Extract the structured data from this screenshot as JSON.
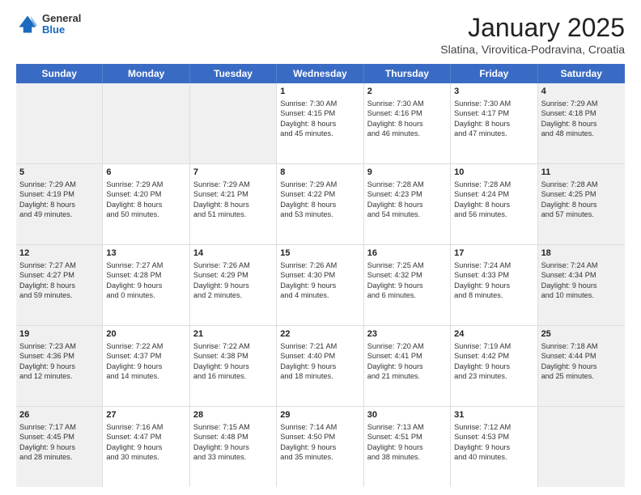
{
  "header": {
    "logo_general": "General",
    "logo_blue": "Blue",
    "month_title": "January 2025",
    "location": "Slatina, Virovitica-Podravina, Croatia"
  },
  "weekdays": [
    "Sunday",
    "Monday",
    "Tuesday",
    "Wednesday",
    "Thursday",
    "Friday",
    "Saturday"
  ],
  "rows": [
    [
      {
        "day": "",
        "text": "",
        "shaded": true,
        "empty": true
      },
      {
        "day": "",
        "text": "",
        "shaded": true,
        "empty": true
      },
      {
        "day": "",
        "text": "",
        "shaded": true,
        "empty": true
      },
      {
        "day": "1",
        "text": "Sunrise: 7:30 AM\nSunset: 4:15 PM\nDaylight: 8 hours\nand 45 minutes.",
        "shaded": false
      },
      {
        "day": "2",
        "text": "Sunrise: 7:30 AM\nSunset: 4:16 PM\nDaylight: 8 hours\nand 46 minutes.",
        "shaded": false
      },
      {
        "day": "3",
        "text": "Sunrise: 7:30 AM\nSunset: 4:17 PM\nDaylight: 8 hours\nand 47 minutes.",
        "shaded": false
      },
      {
        "day": "4",
        "text": "Sunrise: 7:29 AM\nSunset: 4:18 PM\nDaylight: 8 hours\nand 48 minutes.",
        "shaded": true
      }
    ],
    [
      {
        "day": "5",
        "text": "Sunrise: 7:29 AM\nSunset: 4:19 PM\nDaylight: 8 hours\nand 49 minutes.",
        "shaded": true
      },
      {
        "day": "6",
        "text": "Sunrise: 7:29 AM\nSunset: 4:20 PM\nDaylight: 8 hours\nand 50 minutes.",
        "shaded": false
      },
      {
        "day": "7",
        "text": "Sunrise: 7:29 AM\nSunset: 4:21 PM\nDaylight: 8 hours\nand 51 minutes.",
        "shaded": false
      },
      {
        "day": "8",
        "text": "Sunrise: 7:29 AM\nSunset: 4:22 PM\nDaylight: 8 hours\nand 53 minutes.",
        "shaded": false
      },
      {
        "day": "9",
        "text": "Sunrise: 7:28 AM\nSunset: 4:23 PM\nDaylight: 8 hours\nand 54 minutes.",
        "shaded": false
      },
      {
        "day": "10",
        "text": "Sunrise: 7:28 AM\nSunset: 4:24 PM\nDaylight: 8 hours\nand 56 minutes.",
        "shaded": false
      },
      {
        "day": "11",
        "text": "Sunrise: 7:28 AM\nSunset: 4:25 PM\nDaylight: 8 hours\nand 57 minutes.",
        "shaded": true
      }
    ],
    [
      {
        "day": "12",
        "text": "Sunrise: 7:27 AM\nSunset: 4:27 PM\nDaylight: 8 hours\nand 59 minutes.",
        "shaded": true
      },
      {
        "day": "13",
        "text": "Sunrise: 7:27 AM\nSunset: 4:28 PM\nDaylight: 9 hours\nand 0 minutes.",
        "shaded": false
      },
      {
        "day": "14",
        "text": "Sunrise: 7:26 AM\nSunset: 4:29 PM\nDaylight: 9 hours\nand 2 minutes.",
        "shaded": false
      },
      {
        "day": "15",
        "text": "Sunrise: 7:26 AM\nSunset: 4:30 PM\nDaylight: 9 hours\nand 4 minutes.",
        "shaded": false
      },
      {
        "day": "16",
        "text": "Sunrise: 7:25 AM\nSunset: 4:32 PM\nDaylight: 9 hours\nand 6 minutes.",
        "shaded": false
      },
      {
        "day": "17",
        "text": "Sunrise: 7:24 AM\nSunset: 4:33 PM\nDaylight: 9 hours\nand 8 minutes.",
        "shaded": false
      },
      {
        "day": "18",
        "text": "Sunrise: 7:24 AM\nSunset: 4:34 PM\nDaylight: 9 hours\nand 10 minutes.",
        "shaded": true
      }
    ],
    [
      {
        "day": "19",
        "text": "Sunrise: 7:23 AM\nSunset: 4:36 PM\nDaylight: 9 hours\nand 12 minutes.",
        "shaded": true
      },
      {
        "day": "20",
        "text": "Sunrise: 7:22 AM\nSunset: 4:37 PM\nDaylight: 9 hours\nand 14 minutes.",
        "shaded": false
      },
      {
        "day": "21",
        "text": "Sunrise: 7:22 AM\nSunset: 4:38 PM\nDaylight: 9 hours\nand 16 minutes.",
        "shaded": false
      },
      {
        "day": "22",
        "text": "Sunrise: 7:21 AM\nSunset: 4:40 PM\nDaylight: 9 hours\nand 18 minutes.",
        "shaded": false
      },
      {
        "day": "23",
        "text": "Sunrise: 7:20 AM\nSunset: 4:41 PM\nDaylight: 9 hours\nand 21 minutes.",
        "shaded": false
      },
      {
        "day": "24",
        "text": "Sunrise: 7:19 AM\nSunset: 4:42 PM\nDaylight: 9 hours\nand 23 minutes.",
        "shaded": false
      },
      {
        "day": "25",
        "text": "Sunrise: 7:18 AM\nSunset: 4:44 PM\nDaylight: 9 hours\nand 25 minutes.",
        "shaded": true
      }
    ],
    [
      {
        "day": "26",
        "text": "Sunrise: 7:17 AM\nSunset: 4:45 PM\nDaylight: 9 hours\nand 28 minutes.",
        "shaded": true
      },
      {
        "day": "27",
        "text": "Sunrise: 7:16 AM\nSunset: 4:47 PM\nDaylight: 9 hours\nand 30 minutes.",
        "shaded": false
      },
      {
        "day": "28",
        "text": "Sunrise: 7:15 AM\nSunset: 4:48 PM\nDaylight: 9 hours\nand 33 minutes.",
        "shaded": false
      },
      {
        "day": "29",
        "text": "Sunrise: 7:14 AM\nSunset: 4:50 PM\nDaylight: 9 hours\nand 35 minutes.",
        "shaded": false
      },
      {
        "day": "30",
        "text": "Sunrise: 7:13 AM\nSunset: 4:51 PM\nDaylight: 9 hours\nand 38 minutes.",
        "shaded": false
      },
      {
        "day": "31",
        "text": "Sunrise: 7:12 AM\nSunset: 4:53 PM\nDaylight: 9 hours\nand 40 minutes.",
        "shaded": false
      },
      {
        "day": "",
        "text": "",
        "shaded": true,
        "empty": true
      }
    ]
  ]
}
